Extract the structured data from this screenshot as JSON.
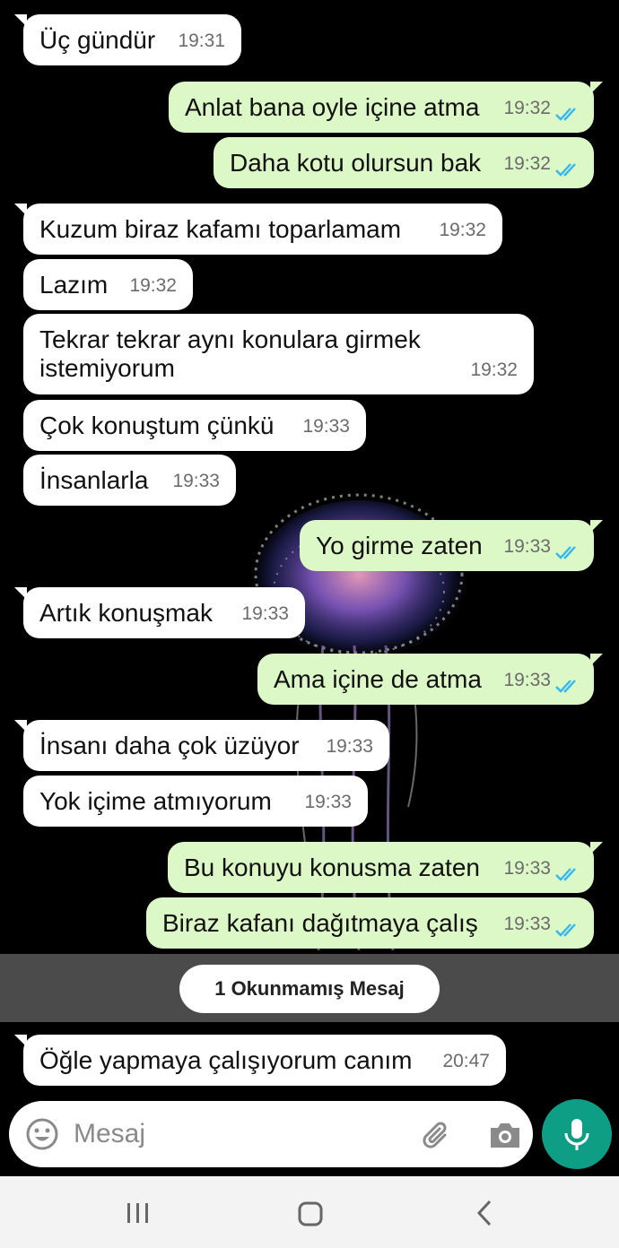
{
  "messages": [
    {
      "dir": "in",
      "text": "Üç gündür",
      "time": "19:31"
    },
    {
      "dir": "out",
      "text": "Anlat bana oyle içine atma",
      "time": "19:32"
    },
    {
      "dir": "out",
      "text": "Daha kotu olursun bak",
      "time": "19:32"
    },
    {
      "dir": "in",
      "text": "Kuzum biraz kafamı toparlamam",
      "time": "19:32"
    },
    {
      "dir": "in",
      "text": "Lazım",
      "time": "19:32"
    },
    {
      "dir": "in",
      "text": "Tekrar tekrar aynı konulara girmek",
      "text2": "istemiyorum",
      "time": "19:32"
    },
    {
      "dir": "in",
      "text": "Çok konuştum çünkü",
      "time": "19:33"
    },
    {
      "dir": "in",
      "text": "İnsanlarla",
      "time": "19:33"
    },
    {
      "dir": "out",
      "text": "Yo girme zaten",
      "time": "19:33"
    },
    {
      "dir": "in",
      "text": "Artık konuşmak",
      "time": "19:33"
    },
    {
      "dir": "out",
      "text": "Ama içine de atma",
      "time": "19:33"
    },
    {
      "dir": "in",
      "text": "İnsanı daha çok üzüyor",
      "time": "19:33"
    },
    {
      "dir": "in",
      "text": "Yok içime atmıyorum",
      "time": "19:33"
    },
    {
      "dir": "out",
      "text": "Bu konuyu konusma zaten",
      "time": "19:33"
    },
    {
      "dir": "out",
      "text": "Biraz kafanı dağıtmaya çalış",
      "time": "19:33"
    },
    {
      "dir": "in",
      "text": "Öğle yapmaya çalışıyorum canım",
      "time": "20:47"
    }
  ],
  "unread_label": "1 Okunmamış Mesaj",
  "composer": {
    "placeholder": "Mesaj"
  },
  "colors": {
    "accent": "#0e9e85",
    "outgoing_bubble": "#dcf8c6",
    "incoming_bubble": "#ffffff",
    "read_ticks": "#34b7f1"
  },
  "icons": [
    "emoji-icon",
    "attach-icon",
    "camera-icon",
    "mic-icon",
    "nav-recent-icon",
    "nav-home-icon",
    "nav-back-icon"
  ]
}
